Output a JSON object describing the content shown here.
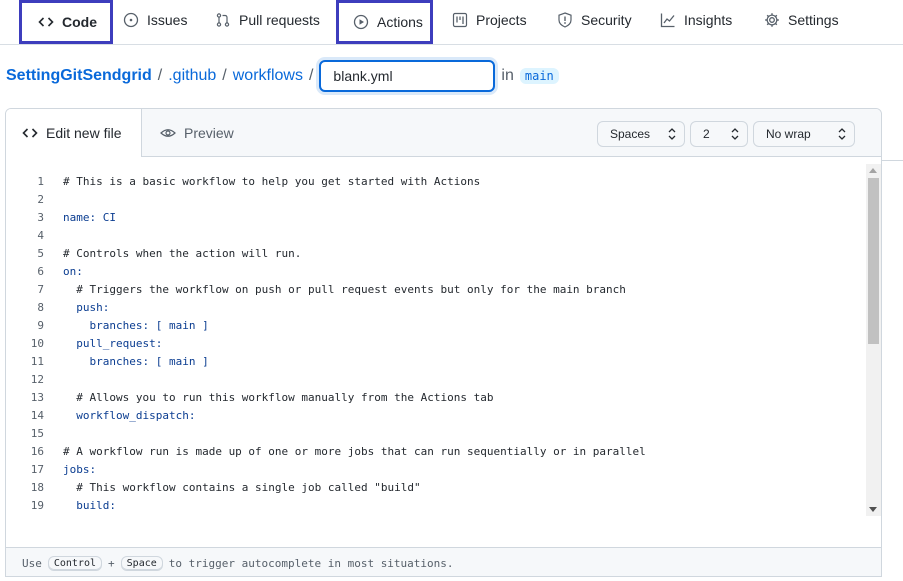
{
  "nav": {
    "tabs": [
      {
        "label": "Code",
        "icon": "code-icon"
      },
      {
        "label": "Issues",
        "icon": "issue-opened-icon"
      },
      {
        "label": "Pull requests",
        "icon": "git-pull-request-icon"
      },
      {
        "label": "Actions",
        "icon": "play-icon"
      },
      {
        "label": "Projects",
        "icon": "project-icon"
      },
      {
        "label": "Security",
        "icon": "shield-icon"
      },
      {
        "label": "Insights",
        "icon": "graph-icon"
      },
      {
        "label": "Settings",
        "icon": "gear-icon"
      }
    ],
    "highlight_color": "#3d3dbd"
  },
  "breadcrumb": {
    "repo": "SettingGitSendgrid",
    "folder1": ".github",
    "folder2": "workflows",
    "separator": "/",
    "filename": "blank.yml",
    "in_label": "in",
    "branch": "main"
  },
  "editor": {
    "tab_edit": "Edit new file",
    "tab_preview": "Preview",
    "indent_mode": "Spaces",
    "indent_size": "2",
    "wrap_mode": "No wrap",
    "lines": [
      {
        "n": "1",
        "text": "# This is a basic workflow to help you get started with Actions"
      },
      {
        "n": "2",
        "text": ""
      },
      {
        "n": "3",
        "text": "name: CI"
      },
      {
        "n": "4",
        "text": ""
      },
      {
        "n": "5",
        "text": "# Controls when the action will run."
      },
      {
        "n": "6",
        "text": "on:"
      },
      {
        "n": "7",
        "text": "  # Triggers the workflow on push or pull request events but only for the main branch"
      },
      {
        "n": "8",
        "text": "  push:"
      },
      {
        "n": "9",
        "text": "    branches: [ main ]"
      },
      {
        "n": "10",
        "text": "  pull_request:"
      },
      {
        "n": "11",
        "text": "    branches: [ main ]"
      },
      {
        "n": "12",
        "text": ""
      },
      {
        "n": "13",
        "text": "  # Allows you to run this workflow manually from the Actions tab"
      },
      {
        "n": "14",
        "text": "  workflow_dispatch:"
      },
      {
        "n": "15",
        "text": ""
      },
      {
        "n": "16",
        "text": "# A workflow run is made up of one or more jobs that can run sequentially or in parallel"
      },
      {
        "n": "17",
        "text": "jobs:"
      },
      {
        "n": "18",
        "text": "  # This workflow contains a single job called \"build\""
      },
      {
        "n": "19",
        "text": "  build:"
      }
    ],
    "footer": {
      "pre": "Use",
      "key1": "Control",
      "plus": "+",
      "key2": "Space",
      "post": "to trigger autocomplete in most situations."
    }
  }
}
